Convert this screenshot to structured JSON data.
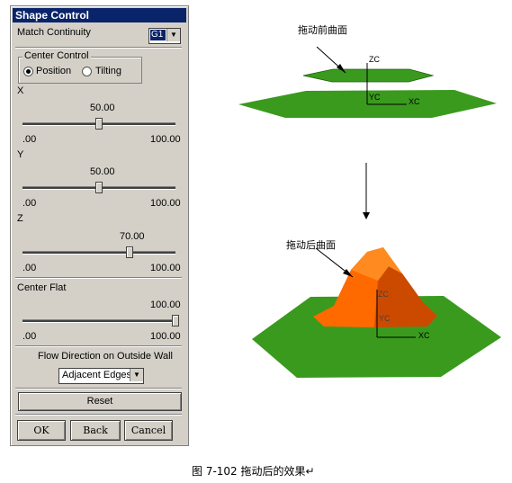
{
  "dialog": {
    "title": "Shape Control",
    "match_continuity_label": "Match Continuity",
    "match_continuity_value": "G1",
    "center_control": {
      "title": "Center Control",
      "options": [
        "Position",
        "Tilting"
      ],
      "selected": "Position"
    },
    "sliders": [
      {
        "label": "X",
        "value": "50.00",
        "value_fraction": 0.5,
        "min": ".00",
        "max": "100.00"
      },
      {
        "label": "Y",
        "value": "50.00",
        "value_fraction": 0.5,
        "min": ".00",
        "max": "100.00"
      },
      {
        "label": "Z",
        "value": "70.00",
        "value_fraction": 0.7,
        "min": ".00",
        "max": "100.00"
      },
      {
        "label": "Center Flat",
        "value": "100.00",
        "value_fraction": 1.0,
        "min": ".00",
        "max": "100.00"
      }
    ],
    "flow_direction_label": "Flow Direction on Outside Wall",
    "flow_direction_value": "Adjacent Edges",
    "reset_label": "Reset",
    "ok_label": "OK",
    "back_label": "Back",
    "cancel_label": "Cancel"
  },
  "illustration": {
    "before_callout": "拖动前曲面",
    "after_callout": "拖动后曲面",
    "axes_top": {
      "zc": "ZC",
      "yc": "YC",
      "xc": "XC"
    },
    "axes_bottom": {
      "zc": "ZC",
      "yc": "YC",
      "xc": "XC"
    },
    "caption": "图 7-102    拖动后的效果↵"
  },
  "colors": {
    "title_bar": "#0a246a",
    "dialog_bg": "#d4d0c8",
    "plane_green": "#3a9a1e",
    "surface_orange": "#ff6a00"
  }
}
